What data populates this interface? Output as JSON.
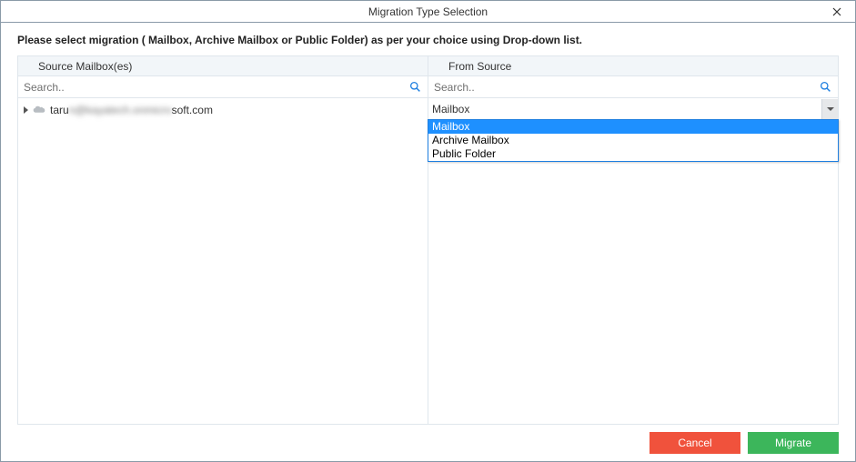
{
  "title": "Migration Type Selection",
  "instruction": "Please select migration ( Mailbox, Archive Mailbox or Public Folder) as per your choice using Drop-down list.",
  "source_panel": {
    "header": "Source Mailbox(es)",
    "search_placeholder": "Search..",
    "mailbox_prefix": "taru",
    "mailbox_blurred": "n@kayatech.onmicro",
    "mailbox_suffix": "soft.com"
  },
  "from_source_panel": {
    "header": "From Source",
    "search_placeholder": "Search..",
    "selected_value": "Mailbox",
    "options": [
      "Mailbox",
      "Archive Mailbox",
      "Public Folder"
    ],
    "highlighted_index": 0
  },
  "footer": {
    "cancel_label": "Cancel",
    "migrate_label": "Migrate"
  }
}
